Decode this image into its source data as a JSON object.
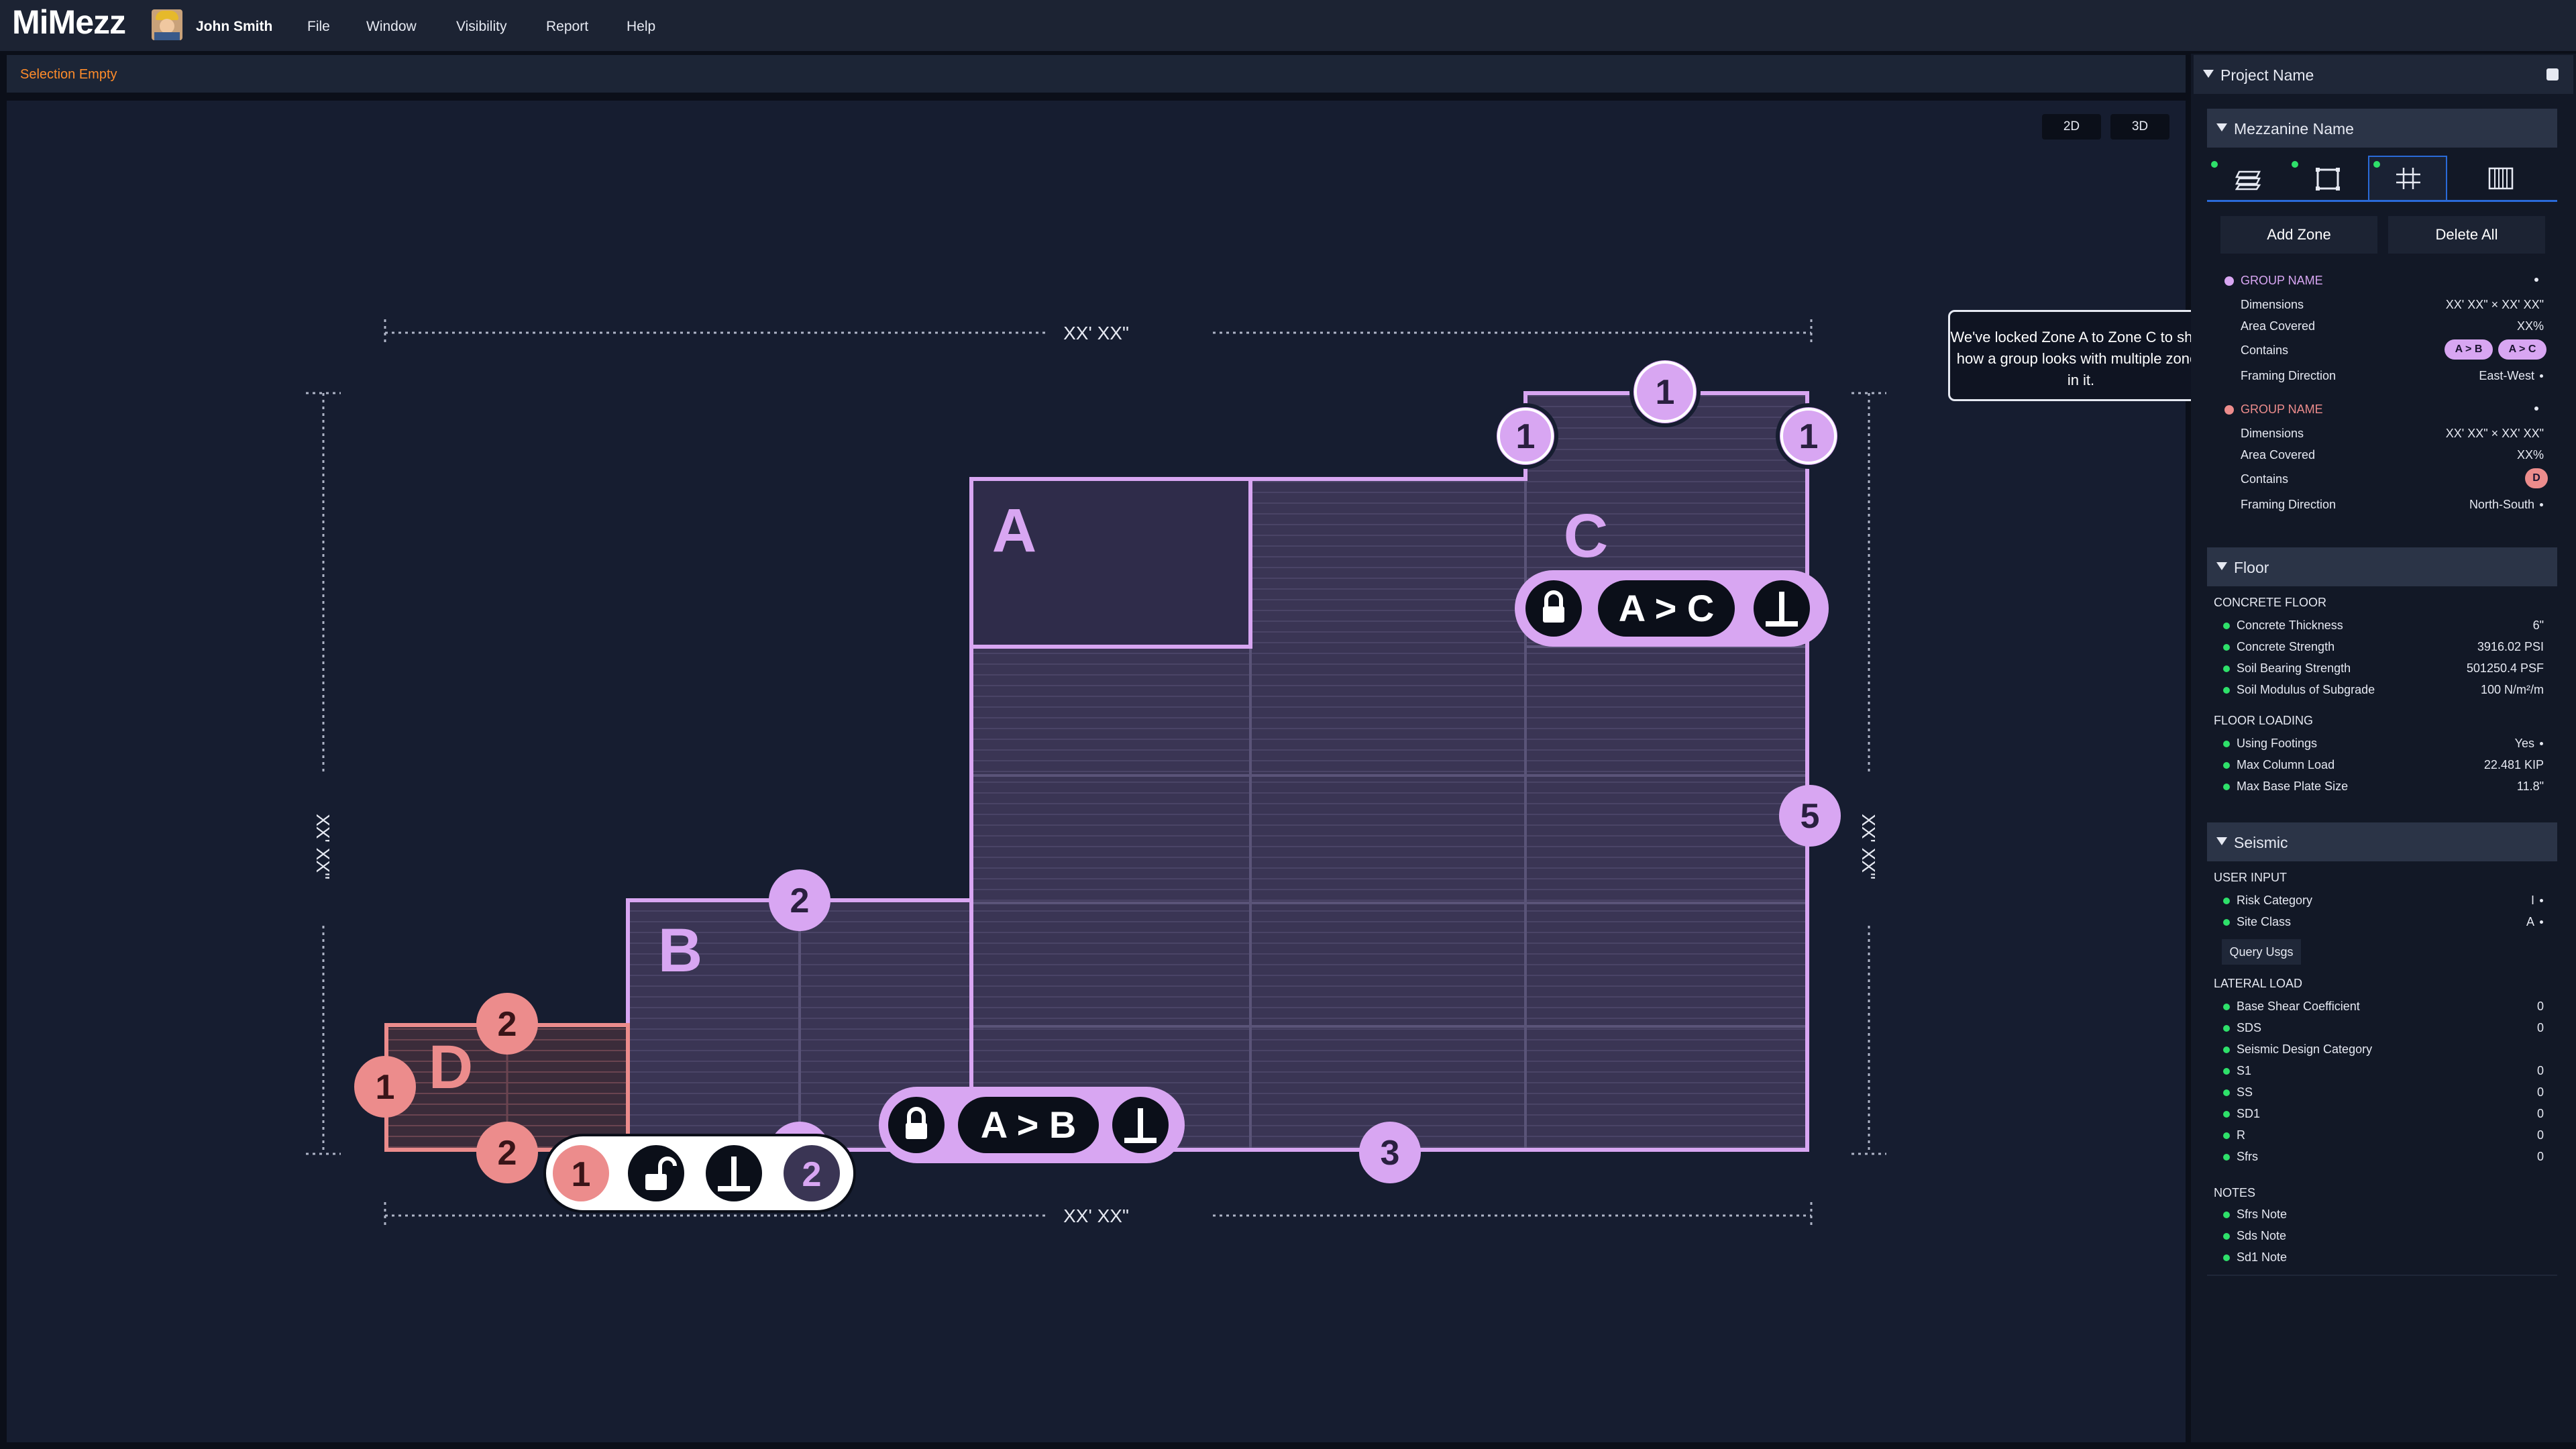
{
  "app": {
    "logo": "MiMezz",
    "user": "John Smith",
    "menu": [
      "File",
      "Window",
      "Visibility",
      "Report",
      "Help"
    ]
  },
  "selection": {
    "status": "Selection Empty"
  },
  "canvas": {
    "view_buttons": [
      "2D",
      "3D"
    ],
    "dimension_labels": {
      "top": "XX' XX\"",
      "bottom": "XX' XX\"",
      "left": "XX' XX\"",
      "right": "XX' XX\""
    },
    "zones": [
      {
        "id": "A",
        "color": "#d8a6f2"
      },
      {
        "id": "B",
        "color": "#d8a6f2"
      },
      {
        "id": "C",
        "color": "#d8a6f2"
      },
      {
        "id": "D",
        "color": "#ec8c8c"
      }
    ],
    "badges": {
      "c_top": "1",
      "c_left": "1",
      "c_right": "1",
      "a_right": "5",
      "a_bottom": "3",
      "b_top": "2",
      "b_bottom": "2",
      "d_top": "2",
      "d_left": "1",
      "d_bottom": "2",
      "pill_d_num": "1",
      "pill_d_num2": "2"
    },
    "lock_pills": {
      "ac": "A > C",
      "ab": "A > B"
    },
    "icons": [
      "lock-icon",
      "unlock-icon",
      "perpendicular-icon"
    ]
  },
  "tooltip": {
    "text": "We've locked Zone A to Zone C to show how a group looks with multiple zones in it."
  },
  "panel": {
    "project": "Project Name",
    "mezzanine": "Mezzanine Name",
    "tabs": [
      "deck-icon",
      "frame-icon",
      "grid-icon",
      "columns-icon"
    ],
    "add_zone": "Add Zone",
    "delete_all": "Delete All",
    "groups": [
      {
        "name": "GROUP NAME",
        "color": "#d8a6f2",
        "dimensions_label": "Dimensions",
        "dimensions": "XX' XX\" × XX' XX\"",
        "area_label": "Area Covered",
        "area": "XX%",
        "contains_label": "Contains",
        "contains": [
          "A > B",
          "A > C"
        ],
        "framing_label": "Framing Direction",
        "framing": "East-West"
      },
      {
        "name": "GROUP NAME",
        "color": "#ec8c8c",
        "dimensions_label": "Dimensions",
        "dimensions": "XX' XX\" × XX' XX\"",
        "area_label": "Area Covered",
        "area": "XX%",
        "contains_label": "Contains",
        "contains": [
          "D"
        ],
        "framing_label": "Framing Direction",
        "framing": "North-South"
      }
    ],
    "floor": {
      "title": "Floor",
      "concrete_title": "CONCRETE FLOOR",
      "concrete": [
        {
          "label": "Concrete Thickness",
          "value": "6\""
        },
        {
          "label": "Concrete Strength",
          "value": "3916.02 PSI"
        },
        {
          "label": "Soil Bearing Strength",
          "value": "501250.4 PSF"
        },
        {
          "label": "Soil Modulus of Subgrade",
          "value": "100 N/m²/m"
        }
      ],
      "loading_title": "FLOOR LOADING",
      "loading": [
        {
          "label": "Using Footings",
          "value": "Yes"
        },
        {
          "label": "Max Column Load",
          "value": "22.481 KIP"
        },
        {
          "label": "Max Base Plate Size",
          "value": "11.8\""
        }
      ]
    },
    "seismic": {
      "title": "Seismic",
      "user_input_title": "USER INPUT",
      "user_input": [
        {
          "label": "Risk Category",
          "value": "I"
        },
        {
          "label": "Site Class",
          "value": "A"
        }
      ],
      "query_button": "Query Usgs",
      "lateral_title": "LATERAL LOAD",
      "lateral": [
        {
          "label": "Base Shear Coefficient",
          "value": "0"
        },
        {
          "label": "SDS",
          "value": "0"
        },
        {
          "label": "Seismic Design Category",
          "value": ""
        },
        {
          "label": "S1",
          "value": "0"
        },
        {
          "label": "SS",
          "value": "0"
        },
        {
          "label": "SD1",
          "value": "0"
        },
        {
          "label": "R",
          "value": "0"
        },
        {
          "label": "Sfrs",
          "value": "0"
        }
      ],
      "notes_title": "NOTES",
      "notes": [
        {
          "label": "Sfrs Note"
        },
        {
          "label": "Sds Note"
        },
        {
          "label": "Sd1 Note"
        }
      ]
    }
  }
}
